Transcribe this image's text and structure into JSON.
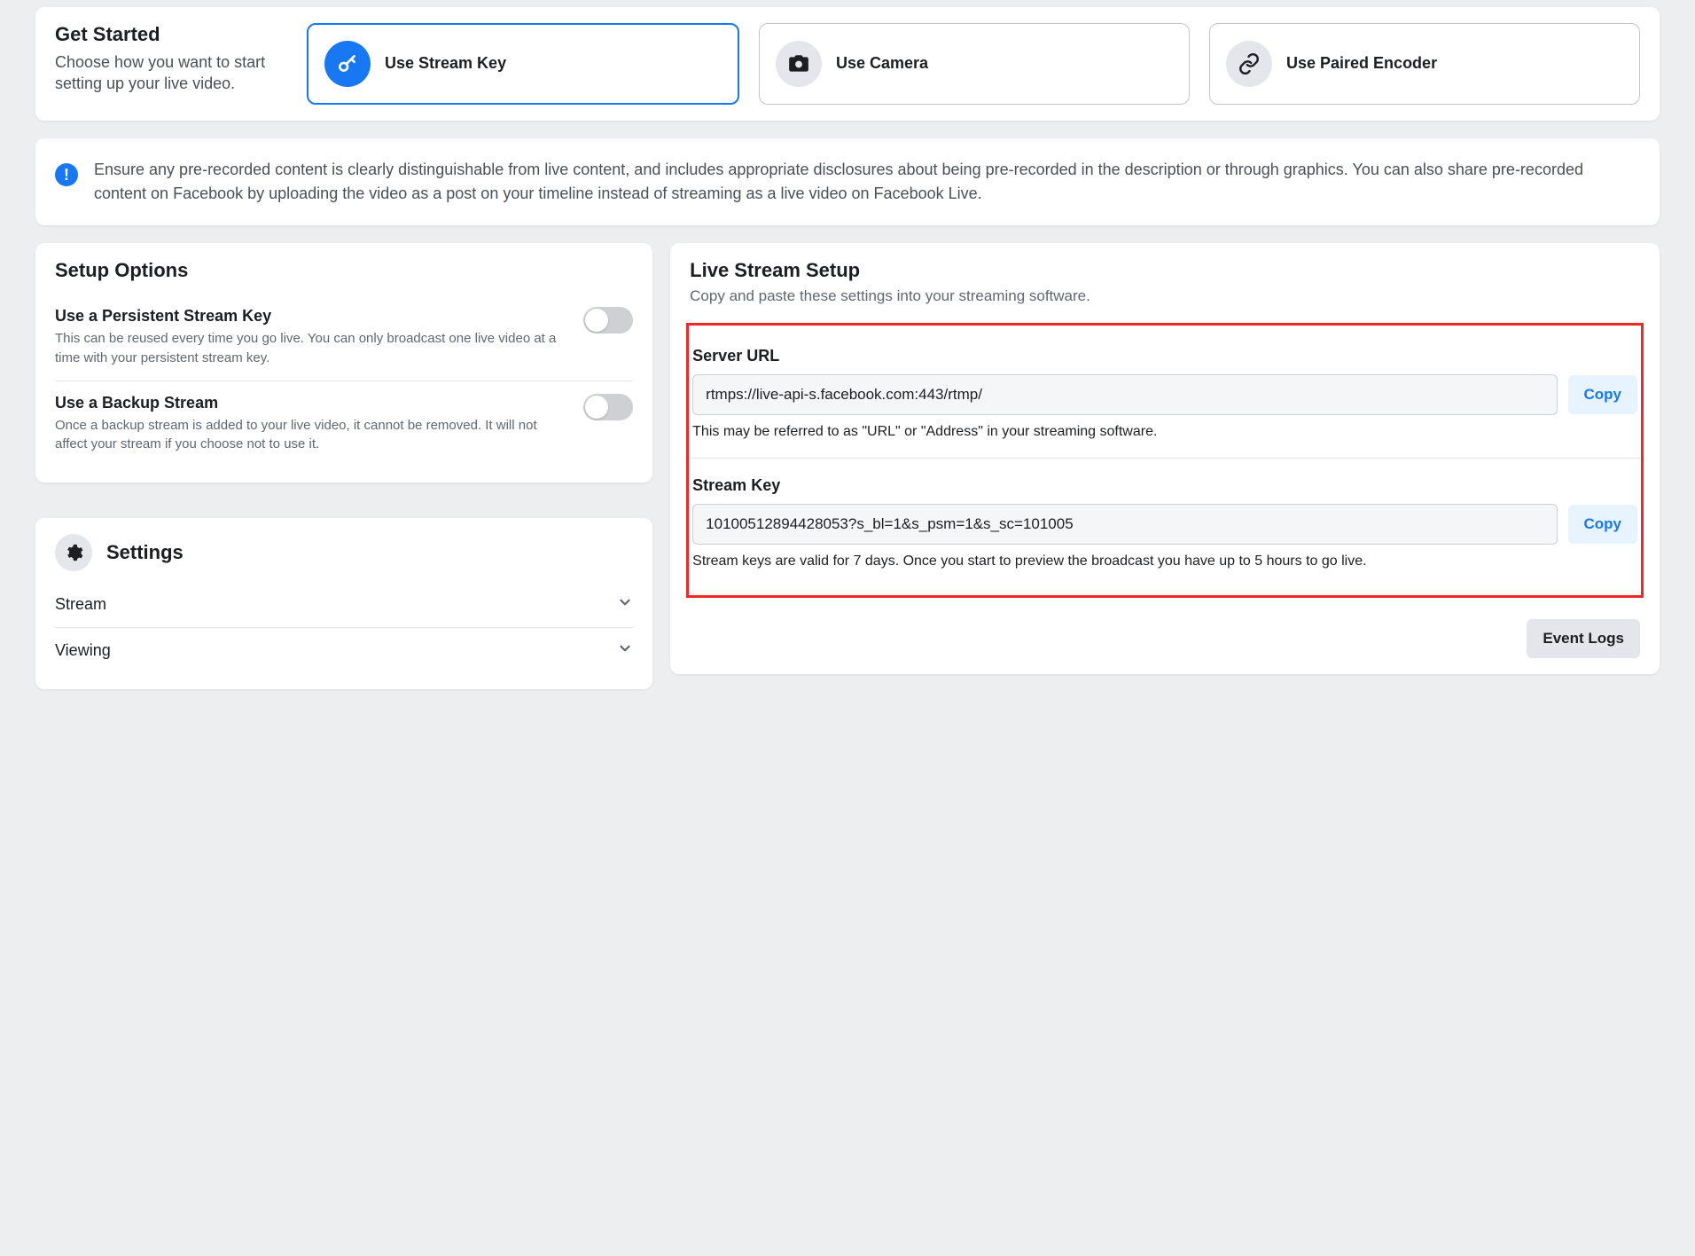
{
  "get_started": {
    "title": "Get Started",
    "subtitle": "Choose how you want to start setting up your live video.",
    "options": [
      {
        "label": "Use Stream Key"
      },
      {
        "label": "Use Camera"
      },
      {
        "label": "Use Paired Encoder"
      }
    ]
  },
  "notice": {
    "text": "Ensure any pre-recorded content is clearly distinguishable from live content, and includes appropriate disclosures about being pre-recorded in the description or through graphics. You can also share pre-recorded content on Facebook by uploading the video as a post on your timeline instead of streaming as a live video on Facebook Live."
  },
  "setup_options": {
    "title": "Setup Options",
    "items": [
      {
        "title": "Use a Persistent Stream Key",
        "desc": "This can be reused every time you go live. You can only broadcast one live video at a time with your persistent stream key."
      },
      {
        "title": "Use a Backup Stream",
        "desc": "Once a backup stream is added to your live video, it cannot be removed. It will not affect your stream if you choose not to use it."
      }
    ]
  },
  "settings": {
    "title": "Settings",
    "items": [
      {
        "label": "Stream"
      },
      {
        "label": "Viewing"
      }
    ]
  },
  "live_stream": {
    "title": "Live Stream Setup",
    "subtitle": "Copy and paste these settings into your streaming software.",
    "server_url": {
      "label": "Server URL",
      "value": "rtmps://live-api-s.facebook.com:443/rtmp/",
      "help": "This may be referred to as \"URL\" or \"Address\" in your streaming software."
    },
    "stream_key": {
      "label": "Stream Key",
      "value": "10100512894428053?s_bl=1&s_psm=1&s_sc=101005",
      "help": "Stream keys are valid for 7 days. Once you start to preview the broadcast you have up to 5 hours to go live."
    },
    "copy_label": "Copy",
    "event_logs": "Event Logs"
  }
}
